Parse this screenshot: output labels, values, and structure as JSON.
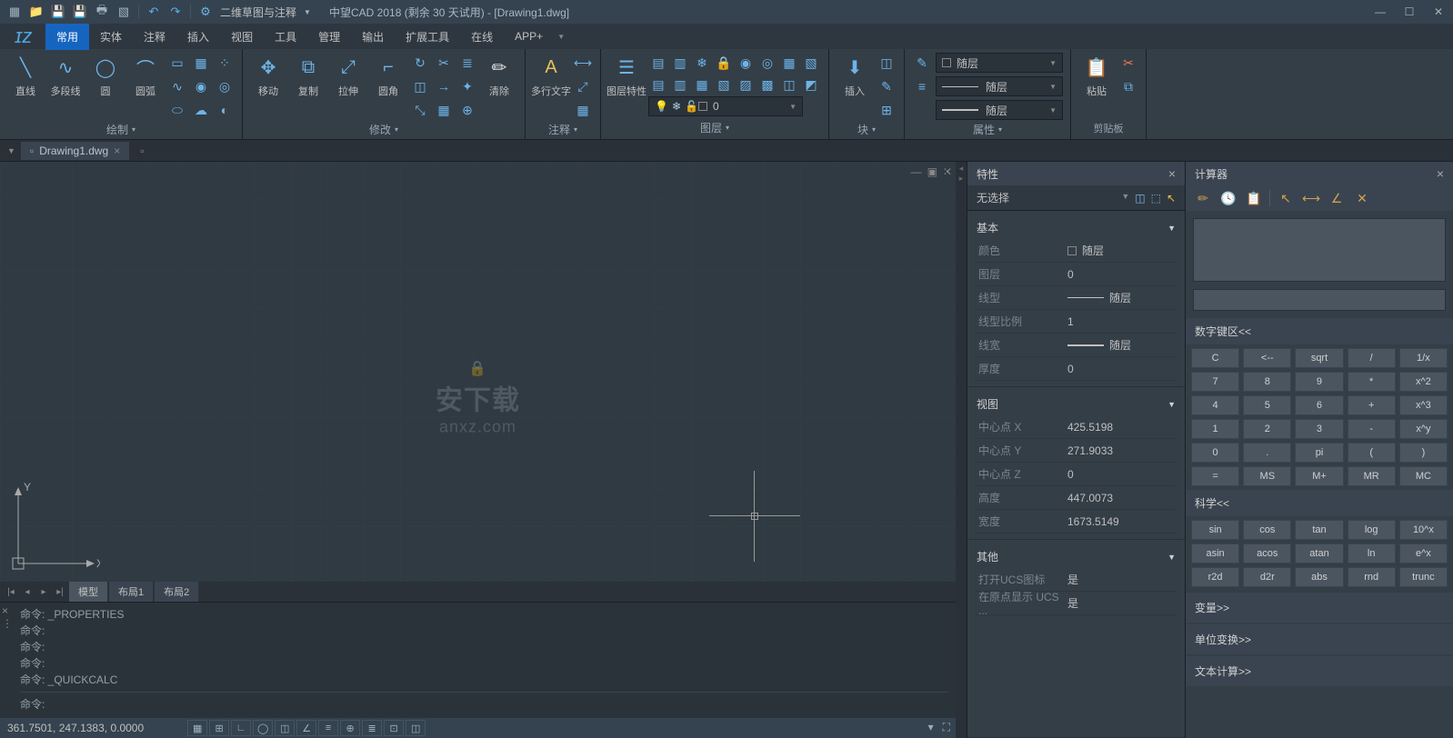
{
  "title": {
    "qat_dropdown": "二维草图与注释",
    "app_title": "中望CAD 2018 (剩余 30 天试用) - [Drawing1.dwg]"
  },
  "menu": [
    "常用",
    "实体",
    "注释",
    "插入",
    "视图",
    "工具",
    "管理",
    "输出",
    "扩展工具",
    "在线",
    "APP+"
  ],
  "ribbon": {
    "draw": {
      "title": "绘制",
      "line": "直线",
      "pline": "多段线",
      "circle": "圆",
      "arc": "圆弧"
    },
    "modify": {
      "title": "修改",
      "move": "移动",
      "copy": "复制",
      "stretch": "拉伸",
      "fillet": "圆角",
      "erase": "清除"
    },
    "annotate": {
      "title": "注释",
      "mtext": "多行文字"
    },
    "layer": {
      "title": "图层",
      "props": "图层特性",
      "current": "0"
    },
    "block": {
      "title": "块",
      "insert": "插入"
    },
    "properties": {
      "title": "属性",
      "bylayer": "随层"
    },
    "clipboard": {
      "title": "剪贴板",
      "paste": "粘贴"
    }
  },
  "doc_tab": "Drawing1.dwg",
  "layout_tabs": [
    "模型",
    "布局1",
    "布局2"
  ],
  "cmd": {
    "l1": "命令: _PROPERTIES",
    "l2": "命令:",
    "l3": "命令:",
    "l4": "命令:",
    "l5": "命令: _QUICKCALC",
    "prompt": "命令:"
  },
  "status_coords": "361.7501, 247.1383, 0.0000",
  "props": {
    "title": "特性",
    "no_sel": "无选择",
    "basic": "基本",
    "color": {
      "label": "颜色",
      "val": "随层"
    },
    "layer": {
      "label": "图层",
      "val": "0"
    },
    "ltype": {
      "label": "线型",
      "val": "随层"
    },
    "ltscale": {
      "label": "线型比例",
      "val": "1"
    },
    "lweight": {
      "label": "线宽",
      "val": "随层"
    },
    "thickness": {
      "label": "厚度",
      "val": "0"
    },
    "view": "视图",
    "cx": {
      "label": "中心点 X",
      "val": "425.5198"
    },
    "cy": {
      "label": "中心点 Y",
      "val": "271.9033"
    },
    "cz": {
      "label": "中心点 Z",
      "val": "0"
    },
    "height": {
      "label": "高度",
      "val": "447.0073"
    },
    "width": {
      "label": "宽度",
      "val": "1673.5149"
    },
    "other": "其他",
    "ucs_icon": {
      "label": "打开UCS图标",
      "val": "是"
    },
    "ucs_origin": {
      "label": "在原点显示 UCS ...",
      "val": "是"
    }
  },
  "calc": {
    "title": "计算器",
    "numpad_hdr": "数字键区<<",
    "sci_hdr": "科学<<",
    "vars": "变量>>",
    "units": "单位变换>>",
    "textcalc": "文本计算>>",
    "keys": [
      [
        "C",
        "<--",
        "sqrt",
        "/",
        "1/x"
      ],
      [
        "7",
        "8",
        "9",
        "*",
        "x^2"
      ],
      [
        "4",
        "5",
        "6",
        "+",
        "x^3"
      ],
      [
        "1",
        "2",
        "3",
        "-",
        "x^y"
      ],
      [
        "0",
        ".",
        "pi",
        "(",
        ")"
      ],
      [
        "=",
        "MS",
        "M+",
        "MR",
        "MC"
      ]
    ],
    "sci": [
      [
        "sin",
        "cos",
        "tan",
        "log",
        "10^x"
      ],
      [
        "asin",
        "acos",
        "atan",
        "ln",
        "e^x"
      ],
      [
        "r2d",
        "d2r",
        "abs",
        "rnd",
        "trunc"
      ]
    ]
  },
  "watermark": {
    "l1": "安下载",
    "l2": "anxz.com"
  }
}
